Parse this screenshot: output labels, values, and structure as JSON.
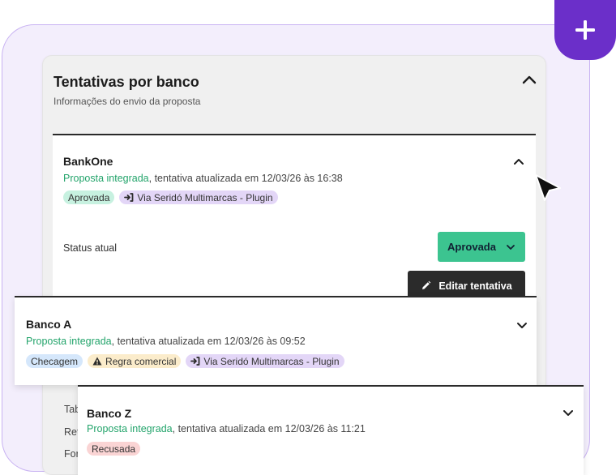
{
  "panel": {
    "title": "Tentativas por banco",
    "subtitle": "Informações do envio da proposta"
  },
  "banks": [
    {
      "name": "BankOne",
      "status_prefix": "Proposta integrada",
      "status_suffix": ", tentativa atualizada em 12/03/26 às 16:38",
      "chips": [
        "Aprovada",
        "Via Seridó Multimarcas - Plugin"
      ],
      "expanded": true
    },
    {
      "name": "Banco A",
      "status_prefix": "Proposta integrada",
      "status_suffix": ", tentativa atualizada em 12/03/26 às 09:52",
      "chips": [
        "Checagem",
        "Regra comercial",
        "Via Seridó Multimarcas - Plugin"
      ],
      "expanded": false
    },
    {
      "name": "Banco Z",
      "status_prefix": "Proposta integrada",
      "status_suffix": ", tentativa atualizada em 12/03/26 às 11:21",
      "chips": [
        "Recusada"
      ],
      "expanded": false
    }
  ],
  "details": {
    "status_label": "Status atual",
    "status_value": "Aprovada",
    "edit_label": "Editar tentativa"
  },
  "hidden_fragments": [
    "Tab",
    "Ret",
    "For"
  ],
  "colors": {
    "accent": "#6b2fc9",
    "success": "#3cc490",
    "integrated_text": "#23a46b"
  },
  "icons": {
    "add": "plus-icon",
    "collapse": "chevron-up-icon",
    "expand": "chevron-down-icon",
    "plugin": "sign-in-icon",
    "warning": "warning-icon",
    "edit": "pencil-icon",
    "pointer": "cursor-icon"
  }
}
